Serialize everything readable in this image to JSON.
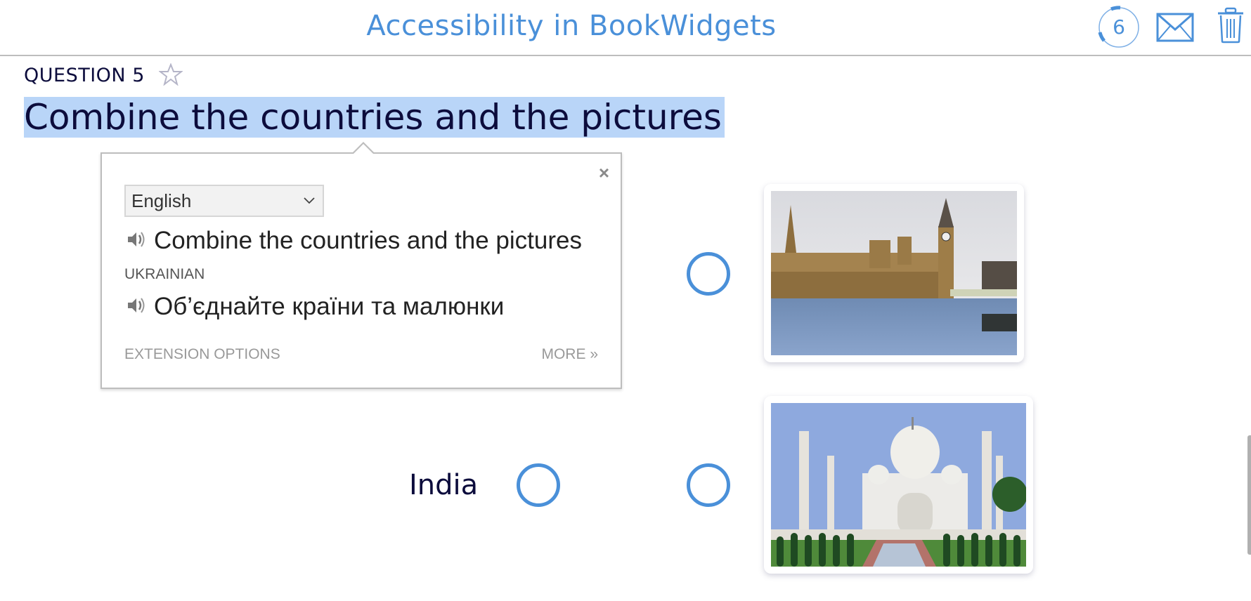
{
  "header": {
    "title": "Accessibility in BookWidgets",
    "progress_count": "6",
    "progress_fraction": 0.25,
    "icons": [
      "progress-ring",
      "mail-icon",
      "trash-icon"
    ]
  },
  "question": {
    "label": "QUESTION 5",
    "star_icon": "star-outline-icon",
    "title": "Combine the countries and the pictures"
  },
  "translate_popup": {
    "close_label": "×",
    "source_language": "English",
    "source_text": "Combine the countries and the pictures",
    "target_language_label": "UKRAINIAN",
    "translated_text": "Об’єднайте країни та малюнки",
    "extension_options_label": "EXTENSION OPTIONS",
    "more_label": "MORE »"
  },
  "matching": {
    "left_items": [
      {
        "label": "India"
      }
    ],
    "right_items": [
      {
        "image": "Houses of Parliament and Big Ben, London"
      },
      {
        "image": "Taj Mahal, Agra"
      }
    ]
  },
  "colors": {
    "accent": "#4a90d9",
    "heading_text": "#0c0c3c",
    "selection": "#b9d5f8"
  }
}
